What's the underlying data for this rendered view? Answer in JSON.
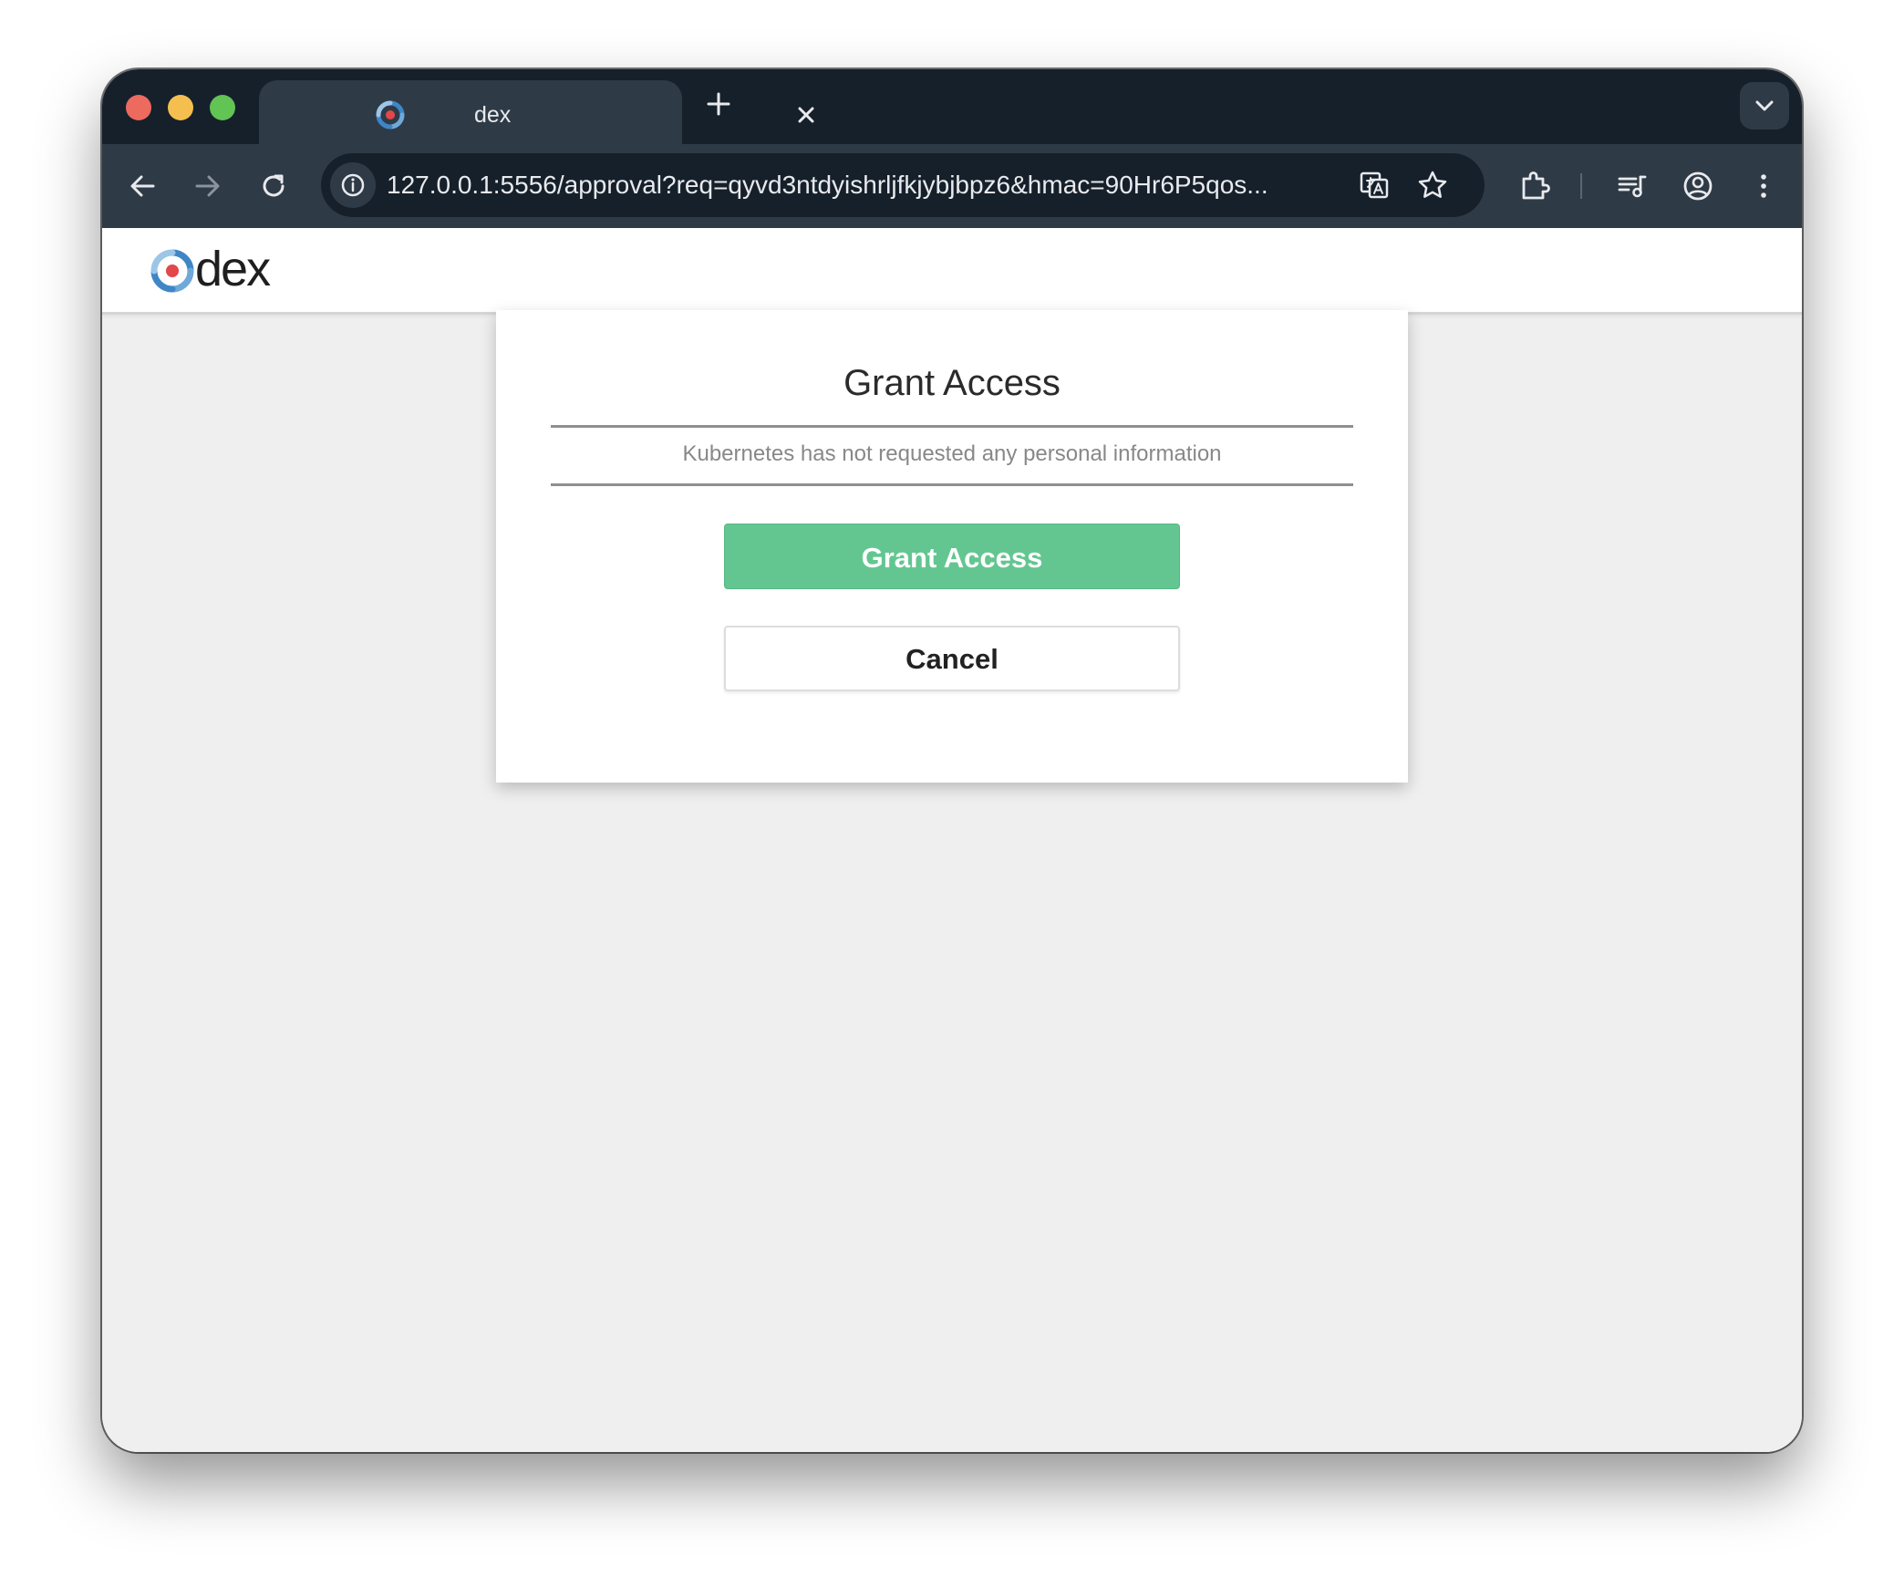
{
  "browser": {
    "tab": {
      "title": "dex",
      "favicon_icon": "dex-logo-icon",
      "close_icon": "close-icon"
    },
    "new_tab_icon": "plus-icon",
    "tab_search_icon": "chevron-down-icon",
    "nav": {
      "back_icon": "arrow-left-icon",
      "forward_icon": "arrow-right-icon",
      "reload_icon": "reload-icon"
    },
    "omnibox": {
      "site_info_icon": "info-icon",
      "url": "127.0.0.1:5556/approval?req=qyvd3ntdyishrljfkjybjbpz6&hmac=90Hr6P5qos...",
      "translate_icon": "translate-icon",
      "bookmark_icon": "star-icon"
    },
    "toolbar_icons": [
      "extensions-icon",
      "reading-list-icon",
      "profile-icon",
      "more-vertical-icon"
    ]
  },
  "page": {
    "header": {
      "logo_text": "dex"
    },
    "approval": {
      "title": "Grant Access",
      "subtitle": "Kubernetes has not requested any personal information",
      "grant_label": "Grant Access",
      "cancel_label": "Cancel"
    }
  },
  "colors": {
    "tabstrip": "#16202b",
    "toolbar": "#2f3a47",
    "page_background": "#efefef",
    "grant_button": "#63c690",
    "logo_blue": "#3f86c7",
    "logo_red": "#e2474b"
  }
}
